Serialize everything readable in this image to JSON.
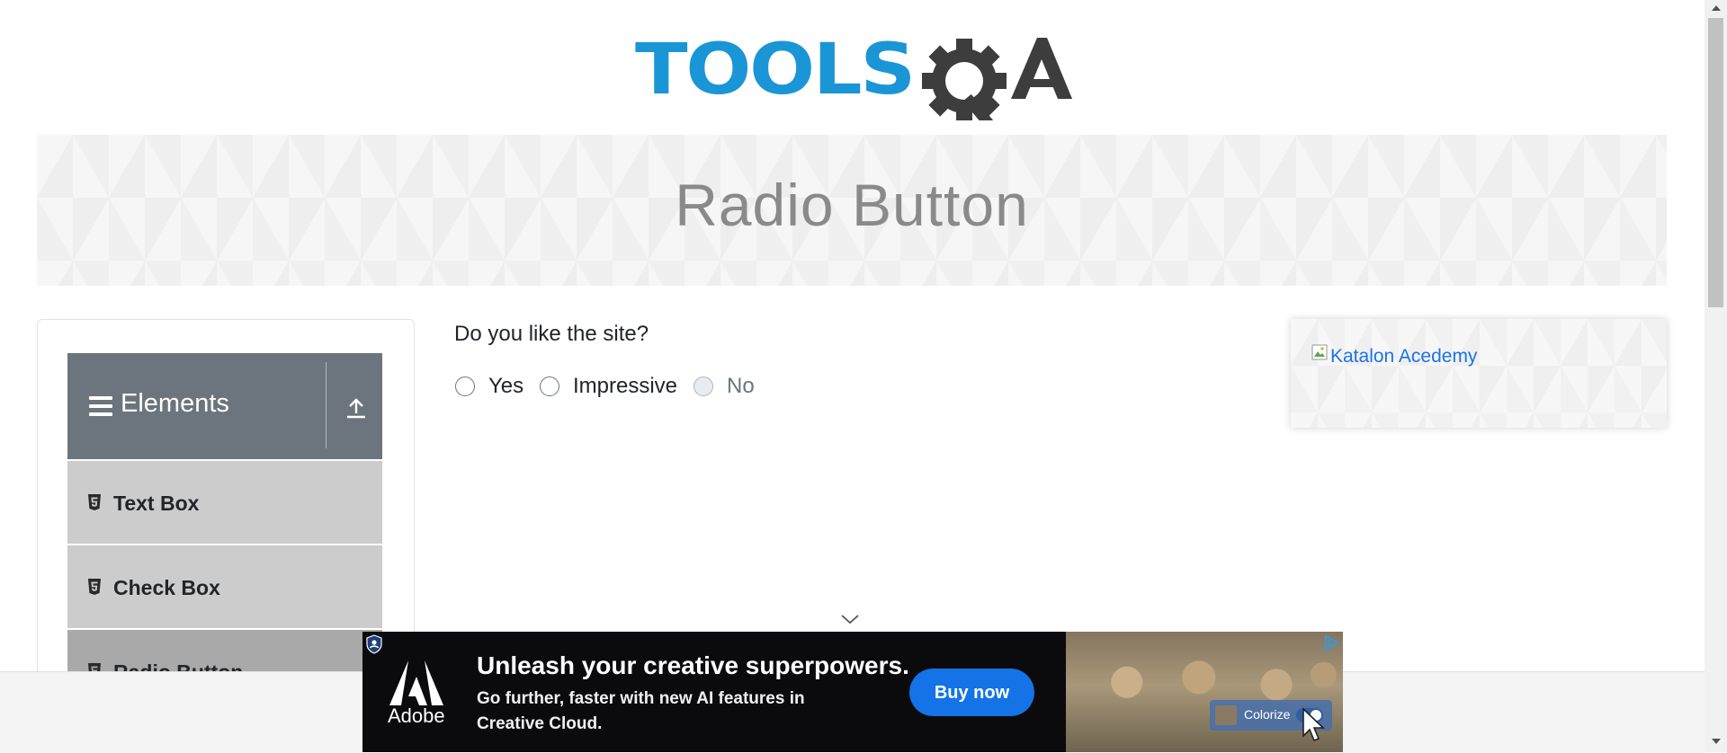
{
  "header": {
    "logo_text": "TOOLSQA",
    "logo_colors": {
      "tools": "#1a96d6",
      "qa": "#3d3d3d"
    }
  },
  "banner": {
    "title": "Radio Button"
  },
  "sidebar": {
    "group_title": "Elements",
    "group_icon": "hamburger-icon",
    "collapse_icon": "upload-icon",
    "items": [
      {
        "label": "Text Box",
        "icon": "html5-icon"
      },
      {
        "label": "Check Box",
        "icon": "html5-icon"
      },
      {
        "label": "Radio Button",
        "icon": "html5-icon"
      }
    ]
  },
  "main": {
    "question": "Do you like the site?",
    "options": [
      {
        "label": "Yes",
        "checked": false,
        "disabled": false
      },
      {
        "label": "Impressive",
        "checked": false,
        "disabled": false
      },
      {
        "label": "No",
        "checked": false,
        "disabled": true
      }
    ]
  },
  "side_ad": {
    "link_text": "Katalon Acedemy"
  },
  "bottom_ad": {
    "brand": "Adobe",
    "headline": "Unleash your creative superpowers.",
    "subtext": "Go further, faster with new AI features in Creative Cloud.",
    "cta": "Buy now",
    "feature_label": "Colorize"
  },
  "colors": {
    "accent": "#1473e6",
    "sidebar_header_bg": "#6c757d",
    "sidebar_item_bg": "#cccccc",
    "link": "#1a73e8"
  }
}
